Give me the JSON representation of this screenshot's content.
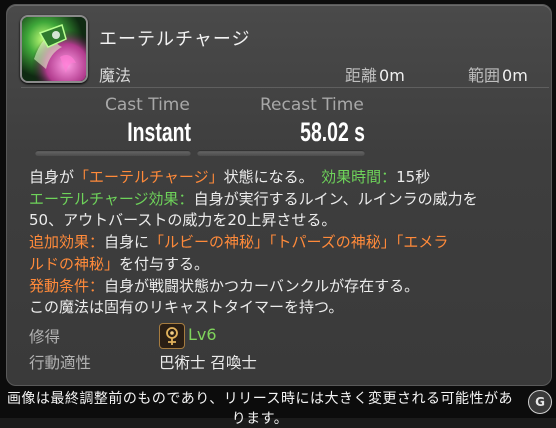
{
  "tooltip": {
    "name": "エーテルチャージ",
    "type": "魔法",
    "range_label": "距離",
    "range_value": "0m",
    "radius_label": "範囲",
    "radius_value": "0m",
    "cast_time_label": "Cast Time",
    "cast_time_value": "Instant",
    "recast_time_label": "Recast Time",
    "recast_time_value": "58.02 s",
    "description": {
      "l1a": "自身が",
      "l1b": "「エーテルチャージ」",
      "l1c": "状態になる。　",
      "l1d": "効果時間：",
      "l1e": "15秒",
      "l2a": "エーテルチャージ効果：",
      "l2b": "自身が実行するルイン、ルインラの威力を",
      "l3": "50、アウトバーストの威力を20上昇させる。",
      "l4a": "追加効果：",
      "l4b": "自身に",
      "l4c": "「ルビーの神秘」",
      "l4d": "「トパーズの神秘」",
      "l4e": "「エメラ",
      "l5a": "ルドの神秘」",
      "l5b": "を付与する。",
      "l6a": "発動条件：",
      "l6b": "自身が戦闘状態かつカーバンクルが存在する。",
      "l7": "この魔法は固有のリキャストタイマーを持つ。"
    },
    "acquire_label": "修得",
    "acquire_level": "Lv6",
    "jobs_label": "行動適性",
    "jobs_value": "巴術士 召喚士"
  },
  "footer": {
    "disclaimer": "画像は最終調整前のものであり、リリース時には大きく変更される可能性があります。",
    "badge": "G"
  },
  "colors": {
    "highlight_orange": "#ff8a3a",
    "highlight_green": "#6ed35a",
    "level_green": "#7fd45c"
  },
  "icons": {
    "skill": "aethercharge-skill-icon",
    "acquire": "arcanist-job-icon"
  }
}
